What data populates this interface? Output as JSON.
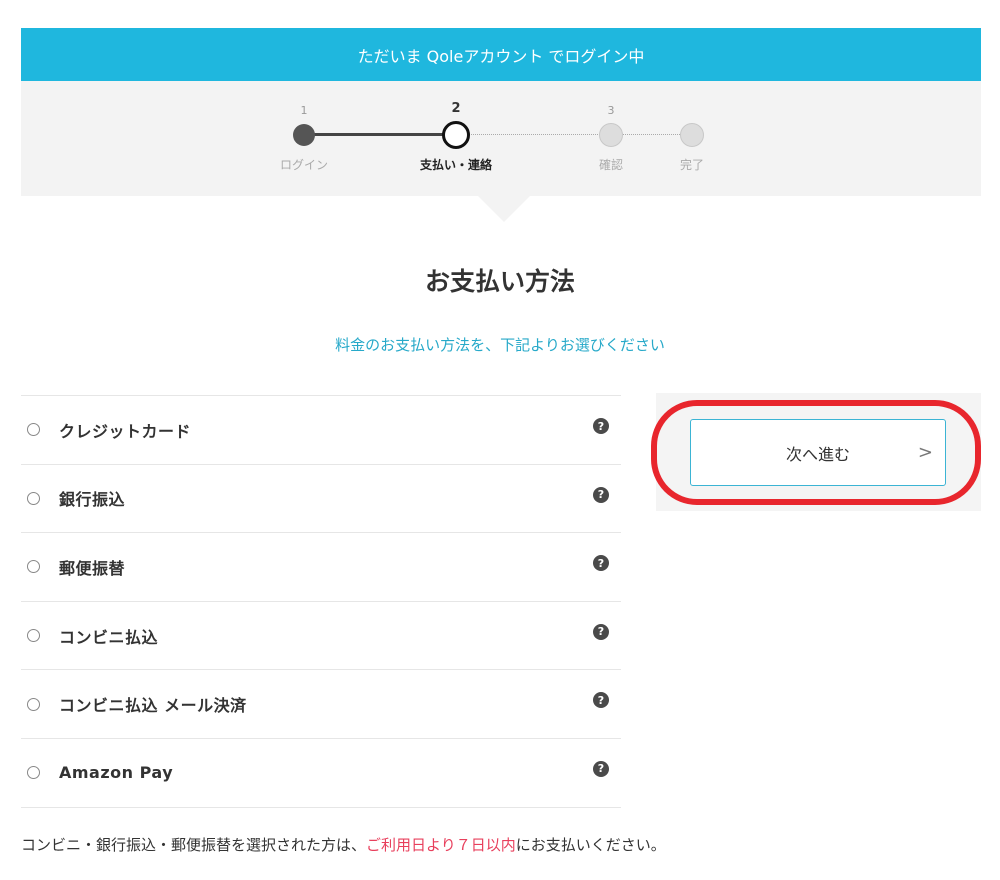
{
  "banner": {
    "text": "ただいま Qoleアカウント でログイン中"
  },
  "stepper": {
    "steps": [
      {
        "number": "1",
        "label": "ログイン",
        "state": "done"
      },
      {
        "number": "2",
        "label": "支払い・連絡",
        "state": "active"
      },
      {
        "number": "3",
        "label": "確認",
        "state": "todo"
      },
      {
        "number": "",
        "label": "完了",
        "state": "todo"
      }
    ]
  },
  "page": {
    "title": "お支払い方法",
    "subtitle": "料金のお支払い方法を、下記よりお選びください"
  },
  "payment_methods": [
    {
      "label": "クレジットカード"
    },
    {
      "label": "銀行振込"
    },
    {
      "label": "郵便振替"
    },
    {
      "label": "コンビニ払込"
    },
    {
      "label": "コンビニ払込 メール決済"
    },
    {
      "label": "Amazon Pay"
    }
  ],
  "help_icon_glyph": "?",
  "next_button": {
    "label": "次へ進む",
    "arrow": ">"
  },
  "footnote": {
    "before": "コンビニ・銀行振込・郵便振替を選択された方は、",
    "highlight": "ご利用日より７日以内",
    "after": "にお支払いください。"
  },
  "colors": {
    "banner": "#1fb7de",
    "accent_text": "#27a9c9",
    "warning_text": "#e8405d",
    "highlight_ring": "#e8262d"
  }
}
